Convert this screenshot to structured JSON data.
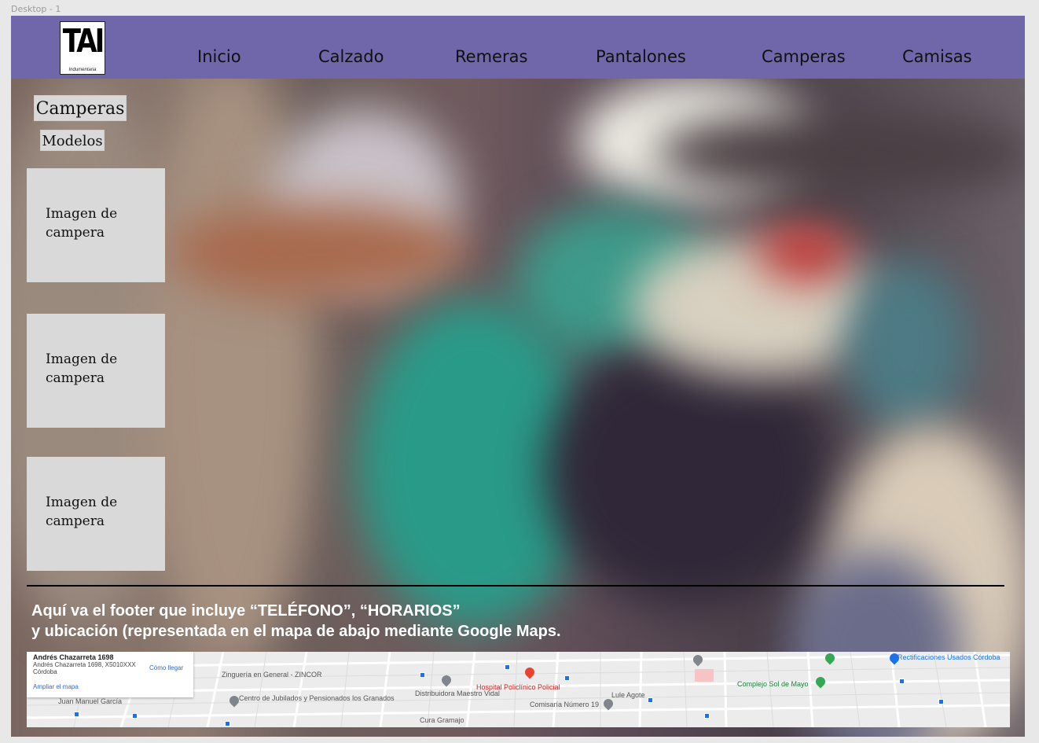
{
  "frame": {
    "label": "Desktop - 1"
  },
  "header": {
    "logo": {
      "mark": "TAI",
      "subtitle": "Indumentaria"
    },
    "nav": [
      "Inicio",
      "Calzado",
      "Remeras",
      "Pantalones",
      "Camperas",
      "Camisas"
    ]
  },
  "section": {
    "title": "Camperas",
    "subtitle": "Modelos"
  },
  "cards": [
    {
      "text": "Imagen de campera"
    },
    {
      "text": "Imagen de campera"
    },
    {
      "text": "Imagen de campera"
    }
  ],
  "footer": {
    "line1": "Aquí va el footer que incluye “TELÉFONO”, “HORARIOS”",
    "line2": "y ubicación (representada en el mapa de abajo mediante Google Maps."
  },
  "map": {
    "card": {
      "title": "Andrés Chazarreta 1698",
      "address": "Andrés Chazarreta 1698, X5010XXX",
      "city": "Córdoba",
      "route": "Cómo llegar",
      "link": "Ampliar el mapa"
    },
    "labels": [
      "Zinguería en General - ZINCOR",
      "Centro de Jubilados y Pensionados los Granados",
      "Distribuidora Maestro Vidal",
      "Hospital Policlínico Policial",
      "Comisaría Número 19",
      "Complejo Sol de Mayo",
      "Rectificaciones Usados Córdoba",
      "Lule Agote",
      "Juan Manuel García",
      "Cura Gramajo"
    ]
  },
  "colors": {
    "topbar": "#6f67aa",
    "card": "#d9d9d9",
    "footer_text": "#ffffff"
  }
}
